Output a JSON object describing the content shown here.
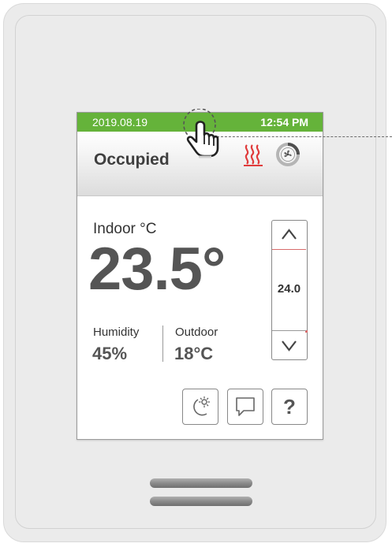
{
  "status_bar": {
    "date": "2019.08.19",
    "time": "12:54 PM",
    "color": "#65b33a"
  },
  "header": {
    "occupancy": "Occupied",
    "heating_icon": "heating-waves-icon",
    "heating_color": "#e03c3c",
    "fan_icon": "fan-icon"
  },
  "indoor": {
    "label": "Indoor °C",
    "temperature": "23.5°"
  },
  "humidity": {
    "label": "Humidity",
    "value": "45%"
  },
  "outdoor": {
    "label": "Outdoor",
    "value": "18°C"
  },
  "setpoint": {
    "value": "24.0",
    "up_icon": "chevron-up-icon",
    "down_icon": "chevron-down-icon"
  },
  "buttons": [
    {
      "name": "night-mode-button",
      "icon": "moon-sun-icon"
    },
    {
      "name": "messages-button",
      "icon": "speech-bubble-icon"
    },
    {
      "name": "help-button",
      "icon": "question-icon",
      "glyph": "?"
    }
  ],
  "overlay": {
    "pointer_icon": "hand-pointer-icon"
  }
}
